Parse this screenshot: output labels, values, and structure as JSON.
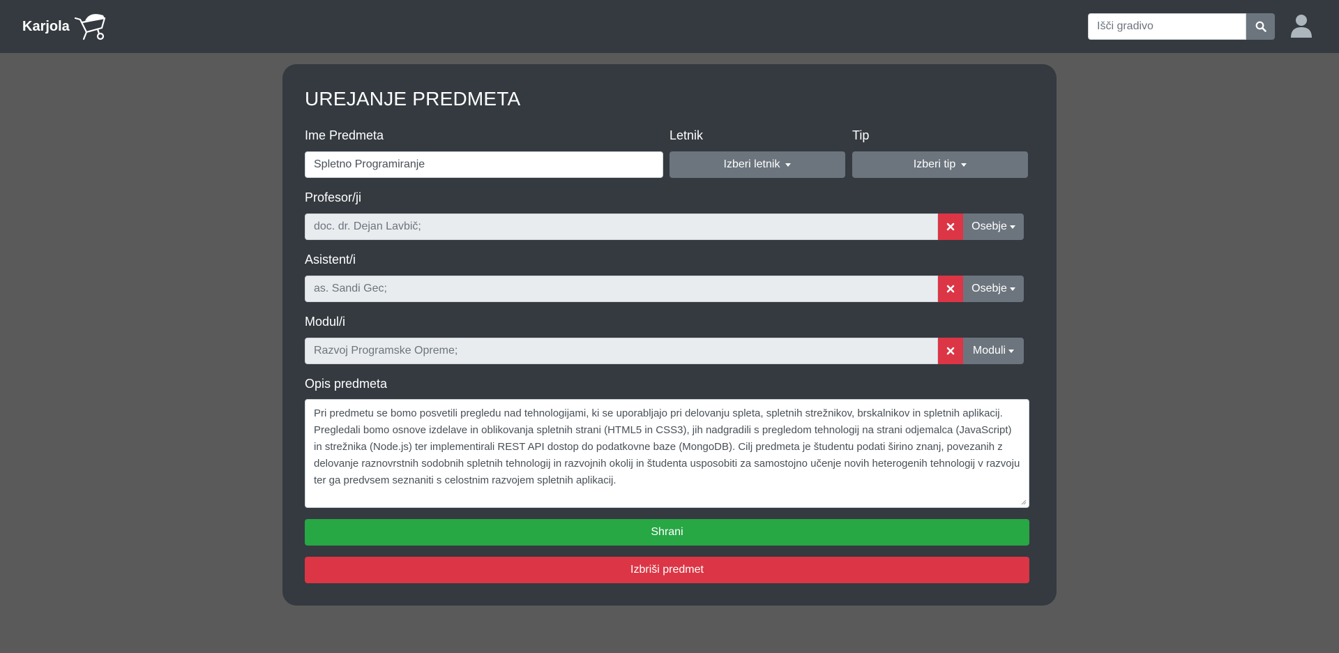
{
  "navbar": {
    "brand": "Karjola",
    "brand_icon": "wheelbarrow-icon",
    "search_placeholder": "Išči gradivo",
    "search_icon": "search-icon",
    "user_icon": "user-icon"
  },
  "form": {
    "title": "UREJANJE PREDMETA",
    "name_label": "Ime Predmeta",
    "name_value": "Spletno Programiranje",
    "year_label": "Letnik",
    "year_button": "Izberi letnik",
    "type_label": "Tip",
    "type_button": "Izberi tip",
    "professors_label": "Profesor/ji",
    "professors_value": "doc. dr. Dejan Lavbič;",
    "professors_dd": "Osebje",
    "assistants_label": "Asistent/i",
    "assistants_value": "as. Sandi Gec;",
    "assistants_dd": "Osebje",
    "modules_label": "Modul/i",
    "modules_value": "Razvoj Programske Opreme;",
    "modules_dd": "Moduli",
    "description_label": "Opis predmeta",
    "description_value": "Pri predmetu se bomo posvetili pregledu nad tehnologijami, ki se uporabljajo pri delovanju spleta, spletnih strežnikov, brskalnikov in spletnih aplikacij. Pregledali bomo osnove izdelave in oblikovanja spletnih strani (HTML5 in CSS3), jih nadgradili s pregledom tehnologij na strani odjemalca (JavaScript) in strežnika (Node.js) ter implementirali REST API dostop do podatkovne baze (MongoDB). Cilj predmeta je študentu podati širino znanj, povezanih z delovanje raznovrstnih sodobnih spletnih tehnologij in razvojnih okolij in študenta usposobiti za samostojno učenje novih heterogenih tehnologij v razvoju ter ga predvsem seznaniti s celostnim razvojem spletnih aplikacij.",
    "save_button": "Shrani",
    "delete_button": "Izbriši predmet"
  },
  "colors": {
    "navbar": "#343a40",
    "card": "#343a40",
    "background": "#5a5a5a",
    "secondary": "#6c757d",
    "danger": "#dc3545",
    "success": "#28a745"
  }
}
